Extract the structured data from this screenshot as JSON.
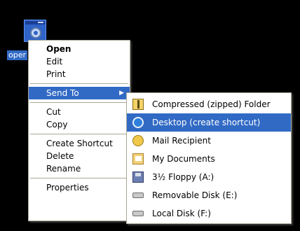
{
  "desktop": {
    "icon_label": "oper",
    "icon_name": "control-panel-icon"
  },
  "context_menu": {
    "items": [
      {
        "label": "Open",
        "bold": true
      },
      {
        "label": "Edit"
      },
      {
        "label": "Print"
      },
      {
        "label": "Send To",
        "has_submenu": true,
        "selected": true
      },
      {
        "label": "Cut"
      },
      {
        "label": "Copy"
      },
      {
        "label": "Create Shortcut"
      },
      {
        "label": "Delete"
      },
      {
        "label": "Rename"
      },
      {
        "label": "Properties"
      }
    ],
    "submenu_arrow": "▶"
  },
  "send_to_menu": {
    "items": [
      {
        "label": "Compressed (zipped) Folder",
        "icon": "zip-folder-icon"
      },
      {
        "label": "Desktop (create shortcut)",
        "icon": "desktop-icon",
        "selected": true
      },
      {
        "label": "Mail Recipient",
        "icon": "mail-recipient-icon"
      },
      {
        "label": "My Documents",
        "icon": "my-documents-icon"
      },
      {
        "label": "3½ Floppy (A:)",
        "icon": "floppy-drive-icon"
      },
      {
        "label": "Removable Disk (E:)",
        "icon": "removable-disk-icon"
      },
      {
        "label": "Local Disk (F:)",
        "icon": "local-disk-icon"
      }
    ]
  },
  "colors": {
    "background": "#000000",
    "selection": "#316ac5",
    "menu_bg": "#ffffff",
    "menu_border": "#aca899"
  }
}
